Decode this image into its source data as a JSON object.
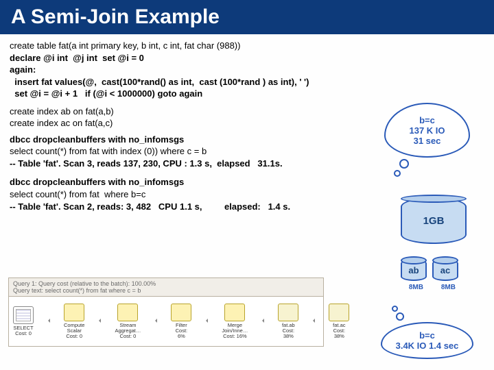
{
  "title": "A Semi-Join Example",
  "code": {
    "create_table": "create table fat(a int primary key, b int, c int, fat char (988))",
    "declare": "declare @i int  @j int  set @i = 0",
    "again": "again:",
    "insert": "  insert fat values(@,  cast(100*rand() as int,  cast (100*rand ) as int), ' ')",
    "loop": "  set @i = @i + 1   if (@i < 1000000) goto again",
    "idx1": "create index ab on fat(a,b)",
    "idx2": "create index ac on fat(a,c)",
    "dbcc1": "dbcc dropcleanbuffers with no_infomsgs",
    "sel1": "select count(*) from fat with index (0)) where c = b",
    "res1": "-- Table 'fat'. Scan 3, reads 137, 230, CPU : 1.3 s,  elapsed   31.1s.",
    "dbcc2": "dbcc dropcleanbuffers with no_infomsgs",
    "sel2": "select count(*) from fat  where b=c",
    "res2": "-- Table 'fat'. Scan 2, reads: 3, 482   CPU 1.1 s,         elapsed:   1.4 s."
  },
  "clouds": {
    "c1l1": "b=c",
    "c1l2": "137 K IO",
    "c1l3": "31 sec",
    "c2l1": "b=c",
    "c2l2": "3.4K IO   1.4 sec"
  },
  "disks": {
    "main": "1GB",
    "ab": "ab",
    "ac": "ac",
    "cap1": "8MB",
    "cap2": "8MB"
  },
  "plan": {
    "hdr1": "Query 1: Query cost (relative to the batch): 100.00%",
    "hdr2": "Query text: select count(*) from fat where c = b",
    "ops": [
      {
        "t1": "SELECT",
        "t2": "Cost: 0"
      },
      {
        "t1": "Compute Scalar",
        "t2": "Cost: 0"
      },
      {
        "t1": "Stream Aggregat…",
        "t2": "Cost: 0"
      },
      {
        "t1": "Filter",
        "t2": "Cost: 6%"
      },
      {
        "t1": "Merge Join/Inne…",
        "t2": "Cost: 16%"
      },
      {
        "t1": "fat.ab",
        "t2": "Cost: 38%"
      },
      {
        "t1": "fat.ac",
        "t2": "Cost: 38%"
      }
    ]
  }
}
